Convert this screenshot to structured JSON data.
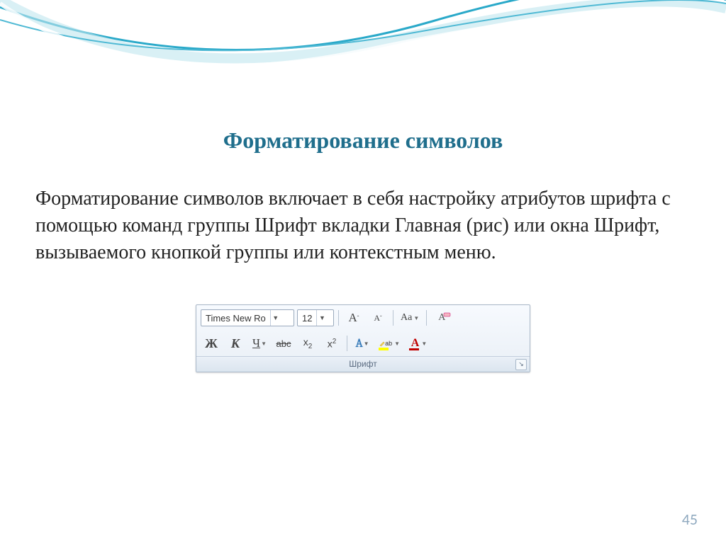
{
  "slide": {
    "title": "Форматирование символов",
    "body": "Форматирование символов включает в себя настройку атрибутов шрифта с помощью команд группы Шрифт вкладки Главная (рис) или окна Шрифт, вызываемого кнопкой группы или контекстным меню.",
    "page_number": "45"
  },
  "ribbon": {
    "font_name": "Times New Ro",
    "font_size": "12",
    "grow_A": "A",
    "shrink_A": "A",
    "case_label": "Aa",
    "clear_label": "A",
    "bold": "Ж",
    "italic": "К",
    "underline": "Ч",
    "strike": "abc",
    "subscript": "x",
    "subscript_sub": "2",
    "superscript": "x",
    "superscript_sup": "2",
    "effects_A": "A",
    "highlight_label": "ab",
    "fontcolor_A": "A",
    "group_label": "Шрифт",
    "launcher_glyph": "↘"
  }
}
